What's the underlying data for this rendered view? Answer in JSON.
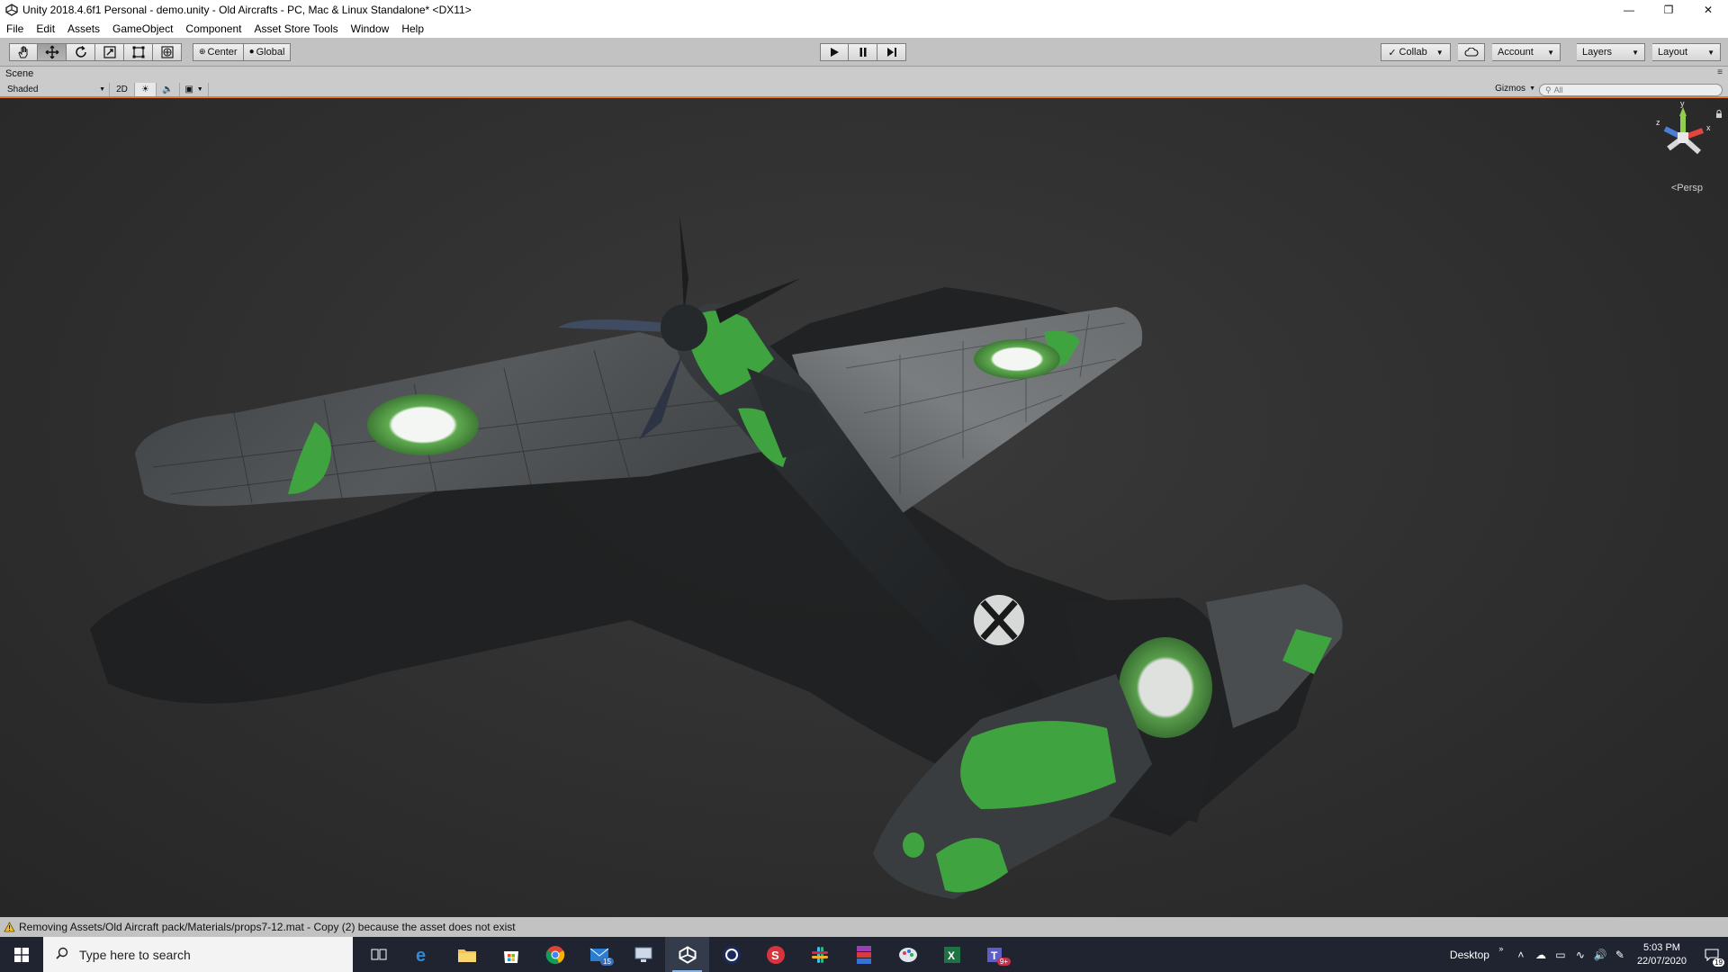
{
  "window": {
    "title": "Unity 2018.4.6f1 Personal - demo.unity - Old Aircrafts - PC, Mac & Linux Standalone* <DX11>",
    "controls": [
      "minimize-icon",
      "restore-icon",
      "close-icon"
    ]
  },
  "menubar": {
    "items": [
      "File",
      "Edit",
      "Assets",
      "GameObject",
      "Component",
      "Asset Store Tools",
      "Window",
      "Help"
    ]
  },
  "toolbar": {
    "tools": [
      "hand-tool-icon",
      "move-tool-icon",
      "rotate-tool-icon",
      "scale-tool-icon",
      "rect-tool-icon",
      "transform-tool-icon"
    ],
    "pivot_label": "Center",
    "space_label": "Global",
    "play_controls": [
      "play-icon",
      "pause-icon",
      "step-icon"
    ],
    "collab_label": "Collab",
    "account_label": "Account",
    "layers_label": "Layers",
    "layout_label": "Layout"
  },
  "scene": {
    "tab_label": "Scene",
    "shading_mode": "Shaded",
    "mode_2d_label": "2D",
    "gizmos_label": "Gizmos",
    "search_placeholder": "All",
    "projection_label": "Persp",
    "axis_labels": {
      "x": "x",
      "y": "y",
      "z": "z"
    }
  },
  "status": {
    "message": "Removing Assets/Old Aircraft pack/Materials/props7-12.mat - Copy (2) because the asset does not exist"
  },
  "taskbar": {
    "search_placeholder": "Type here to search",
    "apps": [
      {
        "name": "task-view-icon",
        "badge": ""
      },
      {
        "name": "edge-icon",
        "badge": ""
      },
      {
        "name": "file-explorer-icon",
        "badge": ""
      },
      {
        "name": "store-icon",
        "badge": ""
      },
      {
        "name": "chrome-icon",
        "badge": ""
      },
      {
        "name": "mail-icon",
        "badge": "15"
      },
      {
        "name": "remote-desktop-icon",
        "badge": ""
      },
      {
        "name": "unity-icon",
        "badge": ""
      },
      {
        "name": "cinema4d-icon",
        "badge": ""
      },
      {
        "name": "substance-icon",
        "badge": ""
      },
      {
        "name": "slack-icon",
        "badge": ""
      },
      {
        "name": "winrar-icon",
        "badge": ""
      },
      {
        "name": "paint-icon",
        "badge": ""
      },
      {
        "name": "excel-icon",
        "badge": ""
      },
      {
        "name": "teams-icon",
        "badge": "9+"
      }
    ],
    "desktop_label": "Desktop",
    "time": "5:03 PM",
    "date": "22/07/2020",
    "notification_count": "19"
  },
  "colors": {
    "toolbar_bg": "#c2c2c2",
    "scene_accent": "#e27b29",
    "aircraft_body": "#2c2f31",
    "camouflage_green": "#3fa43f",
    "taskbar_bg": "#1f2430"
  }
}
